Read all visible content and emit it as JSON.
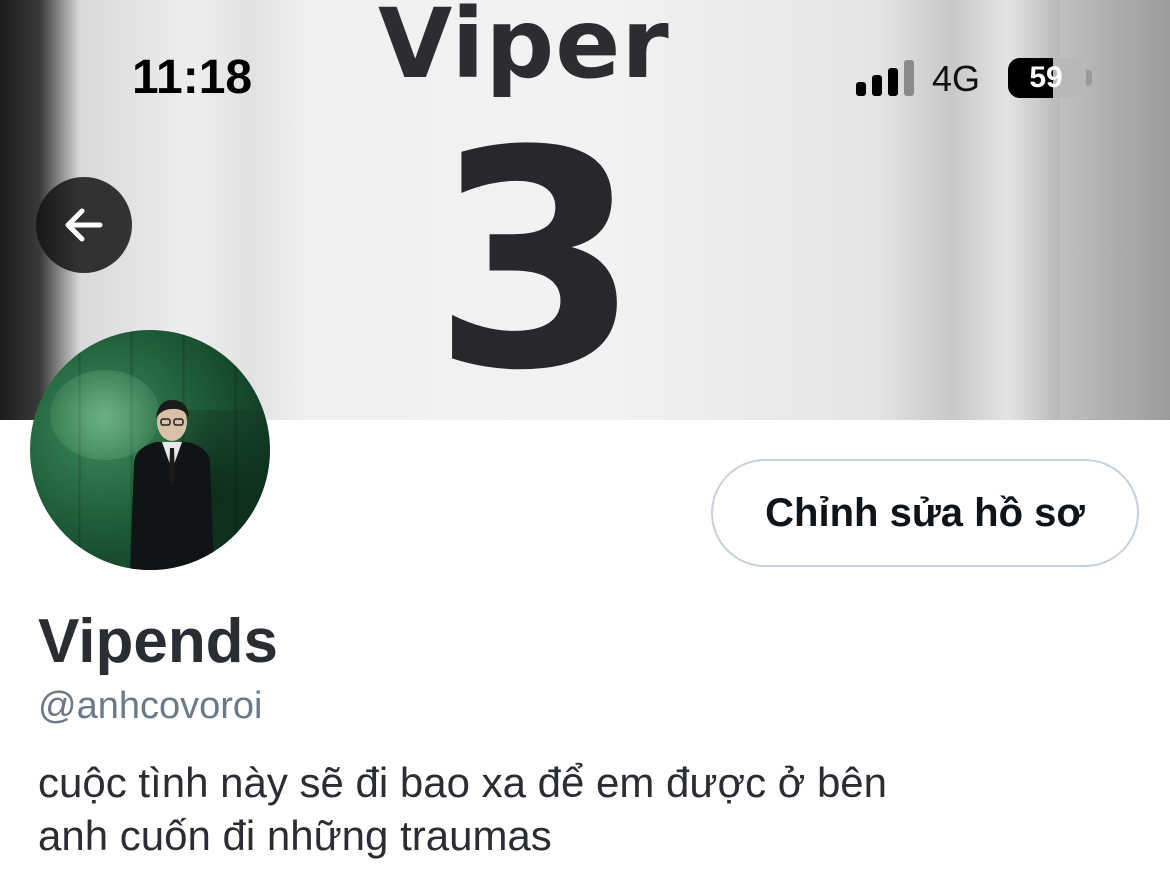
{
  "status_bar": {
    "time": "11:18",
    "network": "4G",
    "battery": "59",
    "battery_level": 0.59,
    "signal_bars_active": 3,
    "signal_bars_total": 4
  },
  "banner": {
    "jersey_name": "Viper",
    "jersey_number": "3"
  },
  "header": {
    "back_icon": "arrow-left-icon"
  },
  "profile": {
    "edit_button_label": "Chỉnh sửa hồ sơ",
    "display_name": "Vipends",
    "handle": "@anhcovoroi",
    "bio_lines": [
      "cuộc tình này sẽ đi bao xa để em được ở bên",
      "anh cuốn đi những traumas"
    ]
  },
  "colors": {
    "text_primary": "#2a2d31",
    "text_secondary": "#6b7a86",
    "button_border": "#c8d1d8"
  }
}
